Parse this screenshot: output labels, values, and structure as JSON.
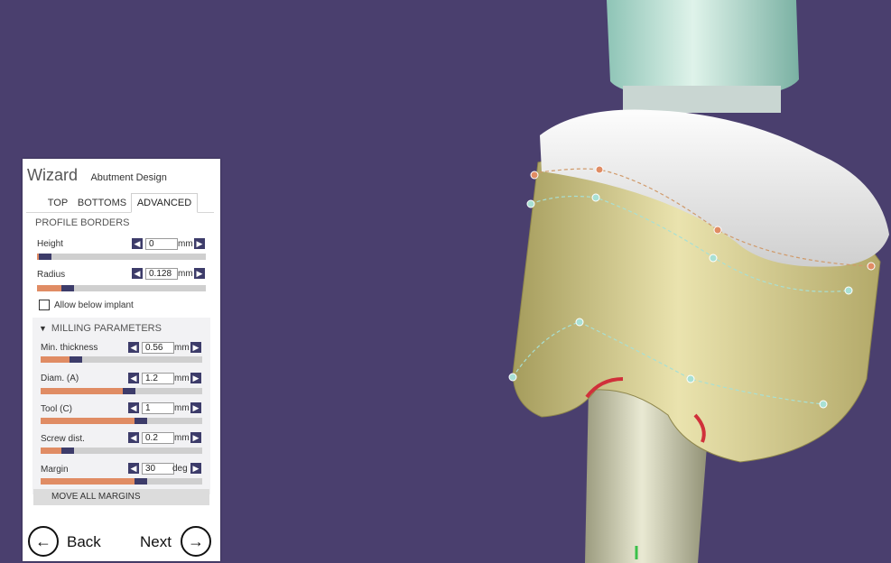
{
  "wizard": {
    "title": "Wizard",
    "subtitle": "Abutment Design"
  },
  "tabs": [
    {
      "label": "TOP",
      "active": false
    },
    {
      "label": "BOTTOMS",
      "active": false
    },
    {
      "label": "ADVANCED",
      "active": true
    }
  ],
  "profile_borders": {
    "title": "PROFILE BORDERS",
    "height": {
      "label": "Height",
      "value": "0",
      "unit": "mm",
      "level": 0.05
    },
    "radius": {
      "label": "Radius",
      "value": "0.128",
      "unit": "mm",
      "level": 0.18
    },
    "allow_below_implant": {
      "label": "Allow below implant",
      "checked": false
    }
  },
  "milling": {
    "title": "MILLING PARAMETERS",
    "min_thickness": {
      "label": "Min. thickness",
      "value": "0.56",
      "unit": "mm",
      "level": 0.22
    },
    "diam": {
      "label": "Diam. (A)",
      "value": "1.2",
      "unit": "mm",
      "level": 0.55
    },
    "tool": {
      "label": "Tool (C)",
      "value": "1",
      "unit": "mm",
      "level": 0.62
    },
    "screw_dist": {
      "label": "Screw dist.",
      "value": "0.2",
      "unit": "mm",
      "level": 0.17
    },
    "margin": {
      "label": "Margin",
      "value": "30",
      "unit": "deg",
      "level": 0.62
    }
  },
  "move_all_margins": {
    "label": "MOVE ALL MARGINS"
  },
  "nav": {
    "back": "Back",
    "next": "Next"
  },
  "colors": {
    "background": "#4a3f6e",
    "slider_fill": "#e08c64",
    "slider_thumb": "#3d3c6a",
    "crown": "#f0f0f0",
    "abutment": "#d4cb8c",
    "shaft": "#c4c4a0"
  },
  "icons": {
    "arrow_left": "◀",
    "arrow_right": "▶",
    "back_icon": "←",
    "next_icon": "→",
    "chevron": "▼"
  }
}
